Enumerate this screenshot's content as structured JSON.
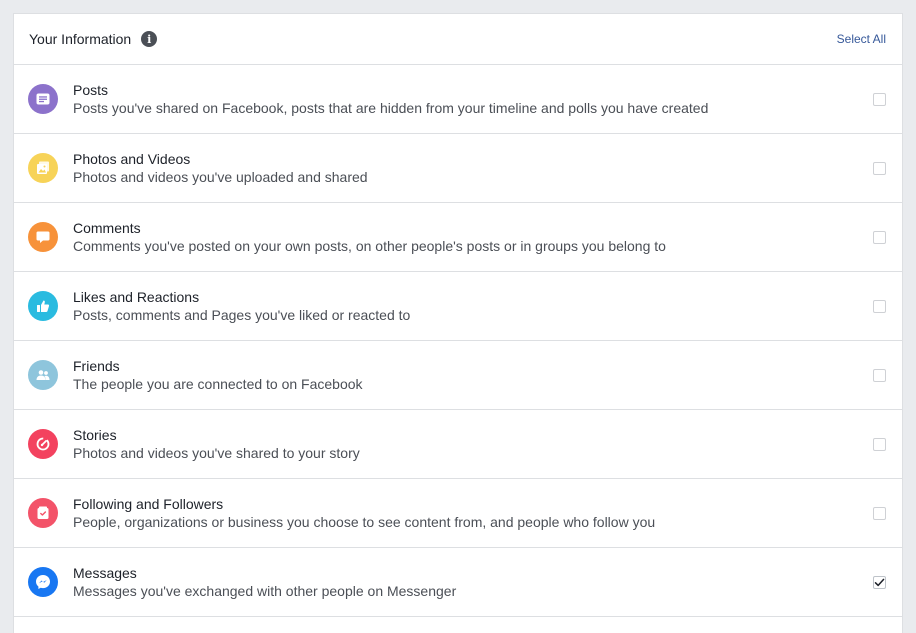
{
  "header": {
    "title": "Your Information",
    "info_icon_glyph": "i",
    "select_all": "Select All"
  },
  "rows": [
    {
      "title": "Posts",
      "description": "Posts you've shared on Facebook, posts that are hidden from your timeline and polls you have created",
      "icon": "posts-icon",
      "color": "#8c72cb",
      "checked": false
    },
    {
      "title": "Photos and Videos",
      "description": "Photos and videos you've uploaded and shared",
      "icon": "photos-icon",
      "color": "#f7d358",
      "checked": false
    },
    {
      "title": "Comments",
      "description": "Comments you've posted on your own posts, on other people's posts or in groups you belong to",
      "icon": "comments-icon",
      "color": "#f7923a",
      "checked": false
    },
    {
      "title": "Likes and Reactions",
      "description": "Posts, comments and Pages you've liked or reacted to",
      "icon": "like-icon",
      "color": "#2abbe0",
      "checked": false
    },
    {
      "title": "Friends",
      "description": "The people you are connected to on Facebook",
      "icon": "friends-icon",
      "color": "#8ec5dc",
      "checked": false
    },
    {
      "title": "Stories",
      "description": "Photos and videos you've shared to your story",
      "icon": "stories-icon",
      "color": "#f3425f",
      "checked": false
    },
    {
      "title": "Following and Followers",
      "description": "People, organizations or business you choose to see content from, and people who follow you",
      "icon": "following-icon",
      "color": "#f35369",
      "checked": false
    },
    {
      "title": "Messages",
      "description": "Messages you've exchanged with other people on Messenger",
      "icon": "messenger-icon",
      "color": "#1877f2",
      "checked": true
    }
  ]
}
